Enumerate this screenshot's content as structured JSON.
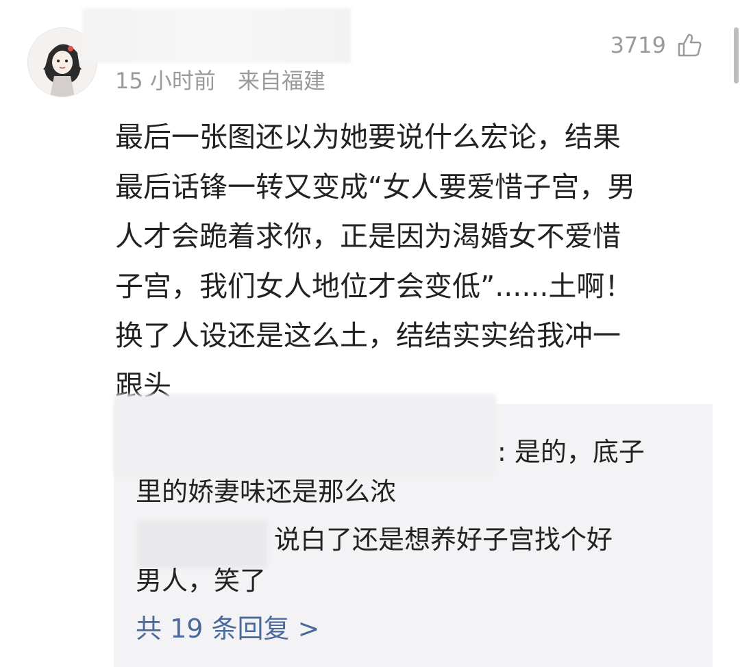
{
  "comment": {
    "time_ago": "15 小时前",
    "location": "来自福建",
    "likes": "3719",
    "text": "最后一张图还以为她要说什么宏论，结果\n最后话锋一转又变成“女人要爱惜子宫，男\n人才会跪着求你，正是因为渴婚女不爱惜\n子宫，我们女人地位才会变低”......土啊！\n换了人设还是这么土，结结实实给我冲一\n跟头"
  },
  "replies": {
    "reply1_line1": ": 是的，底子",
    "reply1_line2": "里的娇妻味还是那么浓",
    "reply2_line1": "说白了还是想养好子宫找个好",
    "reply2_line2": "男人，笑了",
    "more_label": "共 19 条回复 >"
  },
  "icons": {
    "like": "thumbs-up-icon",
    "avatar": "cartoon-girl-avatar"
  },
  "colors": {
    "link": "#4b6a9b",
    "meta_text": "#9a9a9a",
    "body_text": "#222222",
    "reply_bg": "#f3f3f5"
  }
}
